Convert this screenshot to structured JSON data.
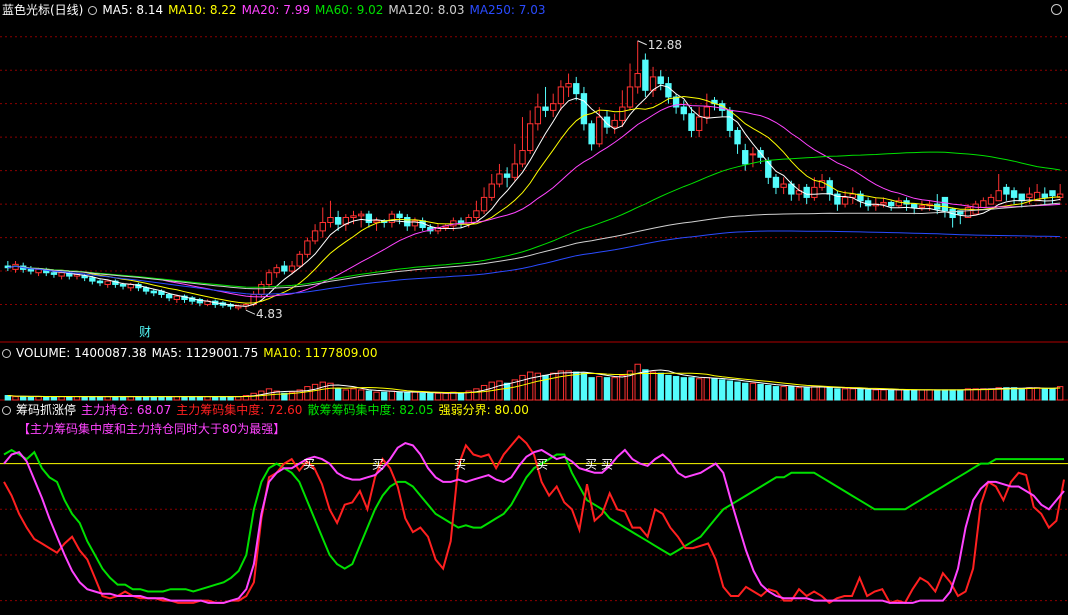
{
  "main_panel": {
    "title": "蓝色光标(日线)",
    "ma_labels": [
      {
        "text": "MA5: 8.14",
        "color": "#ffffff"
      },
      {
        "text": "MA10: 8.22",
        "color": "#ffff00"
      },
      {
        "text": "MA20: 7.99",
        "color": "#ff44ff"
      },
      {
        "text": "MA60: 9.02",
        "color": "#00e000"
      },
      {
        "text": "MA120: 8.03",
        "color": "#d0d0d0"
      },
      {
        "text": "MA250: 7.03",
        "color": "#2a4bff"
      }
    ],
    "high_label": "12.88",
    "low_label": "4.83",
    "marker_text": "财"
  },
  "volume_panel": {
    "labels": [
      {
        "text": "VOLUME: 1400087.38",
        "color": "#ffffff"
      },
      {
        "text": "MA5: 1129001.75",
        "color": "#ffffff"
      },
      {
        "text": "MA10: 1177809.00",
        "color": "#ffff00"
      }
    ]
  },
  "indicator_panel": {
    "title": "筹码抓涨停",
    "labels": [
      {
        "text": "主力持仓: 68.07",
        "color": "#ff44ff"
      },
      {
        "text": "主力筹码集中度: 72.60",
        "color": "#ff2020"
      },
      {
        "text": "散筹筹码集中度: 82.05",
        "color": "#00e000"
      },
      {
        "text": "强弱分界: 80.00",
        "color": "#ffff00"
      }
    ],
    "note": "【主力筹码集中度和主力持仓同时大于80为最强】",
    "signal_glyph": "买"
  },
  "colors": {
    "up": "#ff3232",
    "down": "#54fcfc",
    "grid": "#8b0000",
    "background": "#000000"
  },
  "chart_data": [
    {
      "type": "candlestick",
      "title": "蓝色光标(日线)",
      "ylim": [
        4.0,
        13.5
      ],
      "annotations": [
        {
          "text": "12.88",
          "at_index": 82,
          "value": 12.88
        },
        {
          "text": "4.83",
          "at_index": 31,
          "value": 4.83
        }
      ],
      "close": [
        6.1,
        6.2,
        6.05,
        6.0,
        6.05,
        5.95,
        5.9,
        5.95,
        5.85,
        5.9,
        5.8,
        5.7,
        5.65,
        5.7,
        5.6,
        5.55,
        5.6,
        5.5,
        5.4,
        5.35,
        5.3,
        5.2,
        5.25,
        5.15,
        5.1,
        5.05,
        5.1,
        5.0,
        4.98,
        4.95,
        4.95,
        5.0,
        5.3,
        5.6,
        5.95,
        6.1,
        6.0,
        6.15,
        6.5,
        6.9,
        7.2,
        7.45,
        7.6,
        7.4,
        7.6,
        7.65,
        7.7,
        7.45,
        7.5,
        7.45,
        7.7,
        7.6,
        7.35,
        7.5,
        7.3,
        7.2,
        7.3,
        7.35,
        7.5,
        7.4,
        7.6,
        7.8,
        8.2,
        8.6,
        8.9,
        8.8,
        9.2,
        9.6,
        10.4,
        10.9,
        10.8,
        11.0,
        11.5,
        11.6,
        11.3,
        10.4,
        9.8,
        10.6,
        10.3,
        10.5,
        10.9,
        11.5,
        11.9,
        11.4,
        11.8,
        11.6,
        11.2,
        10.9,
        10.7,
        10.2,
        10.6,
        10.9,
        11.0,
        10.8,
        10.2,
        9.8,
        9.2,
        9.5,
        9.4,
        8.8,
        8.5,
        8.6,
        8.3,
        8.4,
        8.2,
        8.5,
        8.7,
        8.3,
        8.0,
        8.2,
        8.3,
        8.1,
        7.95,
        8.0,
        8.05,
        7.95,
        8.1,
        8.0,
        7.9,
        7.95,
        8.0,
        7.85,
        7.8,
        7.6,
        7.7,
        7.9,
        8.0,
        8.1,
        8.2,
        8.4,
        8.3,
        8.2,
        8.1,
        8.3,
        8.35,
        8.2,
        8.25,
        8.3
      ],
      "open": [
        6.15,
        6.05,
        6.15,
        6.05,
        5.95,
        6.05,
        5.95,
        5.85,
        5.95,
        5.85,
        5.85,
        5.8,
        5.7,
        5.6,
        5.7,
        5.6,
        5.5,
        5.6,
        5.5,
        5.4,
        5.4,
        5.3,
        5.15,
        5.25,
        5.2,
        5.15,
        5.0,
        5.1,
        5.05,
        5.0,
        4.9,
        4.95,
        5.0,
        5.3,
        5.6,
        5.95,
        6.15,
        6.0,
        6.15,
        6.5,
        6.9,
        7.2,
        7.45,
        7.6,
        7.4,
        7.6,
        7.65,
        7.7,
        7.45,
        7.5,
        7.45,
        7.7,
        7.6,
        7.35,
        7.5,
        7.3,
        7.2,
        7.3,
        7.35,
        7.5,
        7.4,
        7.6,
        7.8,
        8.2,
        8.6,
        8.9,
        8.8,
        9.2,
        9.6,
        10.4,
        10.9,
        10.8,
        11.0,
        11.5,
        11.6,
        11.3,
        10.4,
        9.8,
        10.6,
        10.3,
        10.5,
        10.9,
        11.5,
        12.3,
        11.4,
        11.8,
        11.6,
        11.2,
        10.9,
        10.7,
        10.2,
        10.6,
        11.1,
        11.0,
        10.8,
        10.2,
        9.6,
        9.5,
        9.6,
        9.3,
        8.8,
        8.5,
        8.6,
        8.3,
        8.5,
        8.2,
        8.5,
        8.7,
        8.3,
        8.0,
        8.2,
        8.3,
        8.1,
        7.95,
        8.0,
        8.05,
        7.95,
        8.1,
        8.0,
        7.9,
        7.95,
        8.0,
        8.2,
        7.85,
        7.8,
        7.6,
        7.7,
        7.9,
        8.0,
        8.1,
        8.5,
        8.4,
        8.3,
        8.2,
        8.1,
        8.3,
        8.4,
        8.2,
        8.1
      ],
      "high": [
        6.3,
        6.3,
        6.25,
        6.15,
        6.1,
        6.1,
        6.0,
        6.0,
        6.0,
        5.95,
        5.9,
        5.85,
        5.75,
        5.75,
        5.75,
        5.65,
        5.65,
        5.65,
        5.55,
        5.45,
        5.45,
        5.35,
        5.3,
        5.3,
        5.25,
        5.2,
        5.15,
        5.15,
        5.1,
        5.05,
        5.0,
        5.05,
        5.4,
        5.7,
        6.05,
        6.2,
        6.3,
        6.3,
        6.6,
        7.0,
        7.4,
        7.9,
        8.1,
        7.8,
        7.7,
        7.8,
        7.8,
        7.8,
        7.6,
        7.55,
        7.8,
        7.8,
        7.7,
        7.6,
        7.6,
        7.4,
        7.4,
        7.4,
        7.6,
        7.6,
        7.7,
        8.1,
        8.5,
        8.9,
        9.2,
        9.1,
        9.8,
        10.6,
        10.8,
        11.3,
        11.5,
        11.3,
        11.7,
        11.9,
        11.8,
        11.5,
        10.5,
        10.9,
        10.8,
        10.7,
        11.4,
        12.2,
        12.88,
        12.5,
        12.1,
        12.0,
        11.8,
        11.3,
        11.1,
        10.9,
        10.9,
        11.3,
        11.2,
        11.1,
        10.9,
        10.3,
        9.8,
        9.7,
        9.7,
        9.4,
        8.9,
        8.8,
        8.7,
        8.6,
        8.6,
        8.8,
        8.9,
        8.8,
        8.4,
        8.4,
        8.5,
        8.4,
        8.2,
        8.2,
        8.2,
        8.1,
        8.2,
        8.2,
        8.0,
        8.1,
        8.1,
        8.3,
        8.0,
        7.9,
        7.8,
        8.0,
        8.1,
        8.2,
        8.3,
        8.9,
        8.6,
        8.5,
        8.3,
        8.5,
        8.6,
        8.5,
        8.4,
        8.6
      ],
      "low": [
        6.0,
        5.95,
        5.95,
        5.9,
        5.85,
        5.85,
        5.8,
        5.75,
        5.75,
        5.75,
        5.7,
        5.6,
        5.55,
        5.5,
        5.5,
        5.45,
        5.4,
        5.4,
        5.3,
        5.25,
        5.2,
        5.1,
        5.05,
        5.05,
        5.0,
        4.95,
        4.95,
        4.9,
        4.9,
        4.85,
        4.83,
        4.85,
        4.95,
        5.2,
        5.5,
        5.8,
        5.9,
        5.9,
        6.1,
        6.4,
        6.8,
        7.0,
        7.3,
        7.2,
        7.2,
        7.4,
        7.3,
        7.3,
        7.2,
        7.3,
        7.3,
        7.4,
        7.2,
        7.2,
        7.2,
        7.1,
        7.1,
        7.2,
        7.2,
        7.3,
        7.3,
        7.5,
        7.7,
        8.1,
        8.5,
        8.5,
        8.7,
        9.1,
        9.5,
        10.2,
        10.6,
        10.6,
        10.8,
        11.2,
        11.1,
        10.2,
        9.6,
        9.7,
        10.1,
        10.1,
        10.3,
        10.8,
        11.3,
        11.2,
        11.2,
        11.4,
        11.0,
        10.7,
        10.5,
        10.0,
        10.0,
        10.4,
        10.8,
        10.6,
        10.0,
        9.5,
        9.0,
        9.1,
        9.2,
        8.6,
        8.3,
        8.3,
        8.1,
        8.1,
        8.0,
        8.1,
        8.4,
        8.1,
        7.8,
        7.9,
        8.0,
        7.9,
        7.8,
        7.8,
        7.9,
        7.8,
        7.9,
        7.8,
        7.7,
        7.8,
        7.8,
        7.7,
        7.6,
        7.3,
        7.4,
        7.6,
        7.8,
        7.9,
        8.0,
        8.2,
        8.1,
        8.0,
        7.9,
        8.0,
        8.2,
        8.0,
        8.0,
        8.1
      ],
      "moving_averages": [
        {
          "name": "MA5",
          "last": 8.14,
          "color": "#ffffff"
        },
        {
          "name": "MA10",
          "last": 8.22,
          "color": "#ffff00"
        },
        {
          "name": "MA20",
          "last": 7.99,
          "color": "#ff44ff"
        },
        {
          "name": "MA60",
          "last": 9.02,
          "color": "#00e000"
        },
        {
          "name": "MA120",
          "last": 8.03,
          "color": "#d0d0d0"
        },
        {
          "name": "MA250",
          "last": 7.03,
          "color": "#2a4bff"
        }
      ],
      "marker": {
        "text": "财",
        "at_index": 18
      }
    },
    {
      "type": "bar",
      "title": "VOLUME",
      "volume": [
        4,
        3,
        3,
        3,
        3,
        3,
        3,
        3,
        3,
        3,
        3,
        3,
        3,
        3,
        3,
        3,
        3,
        3,
        3,
        3,
        3,
        3,
        3,
        3,
        3,
        3,
        3,
        3,
        3,
        3,
        3,
        4,
        6,
        8,
        10,
        8,
        6,
        7,
        9,
        12,
        14,
        16,
        15,
        10,
        9,
        10,
        9,
        8,
        7,
        7,
        8,
        7,
        7,
        7,
        6,
        6,
        6,
        6,
        7,
        6,
        8,
        10,
        13,
        16,
        17,
        15,
        18,
        22,
        25,
        24,
        22,
        24,
        26,
        26,
        25,
        24,
        20,
        21,
        20,
        20,
        22,
        26,
        32,
        27,
        25,
        24,
        22,
        21,
        20,
        20,
        19,
        20,
        19,
        18,
        17,
        16,
        15,
        15,
        14,
        13,
        12,
        12,
        12,
        11,
        11,
        12,
        12,
        11,
        10,
        10,
        10,
        10,
        9,
        9,
        9,
        9,
        9,
        9,
        9,
        9,
        9,
        9,
        9,
        9,
        9,
        10,
        10,
        10,
        10,
        11,
        11,
        11,
        10,
        11,
        11,
        10,
        10,
        12
      ],
      "ylim": [
        0,
        34
      ],
      "series": [
        {
          "name": "VOLUME",
          "last": 1400087.38
        },
        {
          "name": "MA5",
          "last": 1129001.75
        },
        {
          "name": "MA10",
          "last": 1177809.0
        }
      ]
    },
    {
      "type": "line",
      "title": "筹码抓涨停",
      "ylim": [
        15,
        100
      ],
      "threshold": 80,
      "series": [
        {
          "name": "主力持仓",
          "color": "#ff44ff",
          "values": [
            80,
            84,
            85,
            81,
            73,
            65,
            56,
            48,
            40,
            33,
            28,
            25,
            24,
            23,
            23,
            22,
            22,
            22,
            22,
            21,
            21,
            21,
            20,
            20,
            20,
            20,
            20,
            19,
            19,
            19,
            20,
            21,
            25,
            36,
            58,
            72,
            76,
            78,
            78,
            80,
            82,
            83,
            82,
            80,
            76,
            74,
            73,
            73,
            74,
            75,
            78,
            82,
            87,
            89,
            88,
            84,
            78,
            74,
            72,
            72,
            73,
            72,
            73,
            74,
            75,
            73,
            72,
            74,
            79,
            83,
            85,
            86,
            84,
            82,
            83,
            81,
            78,
            77,
            76,
            76,
            79,
            83,
            86,
            82,
            80,
            79,
            82,
            84,
            81,
            76,
            74,
            75,
            76,
            78,
            80,
            76,
            64,
            53,
            42,
            33,
            27,
            24,
            22,
            21,
            21,
            21,
            21,
            20,
            20,
            20,
            20,
            20,
            20,
            20,
            20,
            20,
            20,
            19,
            19,
            19,
            19,
            20,
            20,
            20,
            20,
            24,
            34,
            52,
            64,
            69,
            72,
            72,
            71,
            70,
            70,
            68,
            66,
            62,
            60,
            64,
            68
          ]
        },
        {
          "name": "主力筹码集中度",
          "color": "#ff2020",
          "values": [
            72,
            66,
            58,
            52,
            47,
            45,
            43,
            41,
            45,
            48,
            42,
            38,
            30,
            22,
            21,
            22,
            24,
            22,
            21,
            21,
            21,
            20,
            20,
            19,
            19,
            19,
            20,
            20,
            19,
            19,
            20,
            20,
            22,
            28,
            56,
            74,
            76,
            80,
            82,
            77,
            81,
            78,
            71,
            60,
            54,
            62,
            63,
            68,
            60,
            74,
            82,
            78,
            70,
            56,
            50,
            52,
            48,
            38,
            34,
            46,
            79,
            88,
            84,
            83,
            84,
            78,
            84,
            88,
            92,
            89,
            84,
            72,
            66,
            70,
            63,
            60,
            51,
            71,
            55,
            58,
            67,
            60,
            59,
            52,
            52,
            48,
            60,
            58,
            52,
            48,
            43,
            43,
            44,
            45,
            38,
            26,
            22,
            22,
            26,
            24,
            22,
            25,
            24,
            20,
            20,
            25,
            22,
            24,
            22,
            19,
            21,
            22,
            22,
            30,
            22,
            24,
            25,
            19,
            20,
            19,
            25,
            30,
            28,
            24,
            32,
            28,
            22,
            24,
            34,
            62,
            72,
            70,
            64,
            72,
            76,
            75,
            61,
            58,
            52,
            55,
            73
          ]
        },
        {
          "name": "散筹筹码集中度",
          "color": "#00e000",
          "values": [
            84,
            86,
            84,
            82,
            85,
            78,
            74,
            72,
            64,
            58,
            54,
            46,
            40,
            34,
            30,
            27,
            27,
            25,
            25,
            24,
            24,
            24,
            25,
            25,
            25,
            24,
            25,
            26,
            27,
            28,
            30,
            33,
            40,
            60,
            72,
            78,
            80,
            78,
            76,
            72,
            64,
            56,
            48,
            40,
            36,
            34,
            36,
            44,
            52,
            60,
            66,
            70,
            72,
            72,
            70,
            66,
            62,
            58,
            56,
            54,
            52,
            53,
            52,
            52,
            54,
            56,
            58,
            62,
            68,
            74,
            78,
            80,
            82,
            84,
            84,
            76,
            70,
            64,
            62,
            60,
            56,
            54,
            52,
            50,
            48,
            46,
            44,
            42,
            40,
            42,
            44,
            46,
            48,
            52,
            56,
            60,
            62,
            64,
            66,
            68,
            70,
            72,
            74,
            74,
            76,
            76,
            76,
            76,
            74,
            72,
            70,
            68,
            66,
            64,
            62,
            60,
            60,
            60,
            60,
            60,
            62,
            64,
            66,
            68,
            70,
            72,
            74,
            76,
            78,
            80,
            80,
            82,
            82,
            82,
            82,
            82,
            82,
            82,
            82,
            82,
            82
          ]
        },
        {
          "name": "强弱分界",
          "color": "#ffff00",
          "values": [
            80,
            80
          ]
        }
      ],
      "signals": [
        {
          "text": "买",
          "at_index": 18
        },
        {
          "text": "买",
          "at_index": 24
        },
        {
          "text": "买",
          "at_index": 34
        },
        {
          "text": "买",
          "at_index": 40
        },
        {
          "text": "买",
          "at_index": 44
        },
        {
          "text": "买",
          "at_index": 45
        }
      ]
    }
  ]
}
